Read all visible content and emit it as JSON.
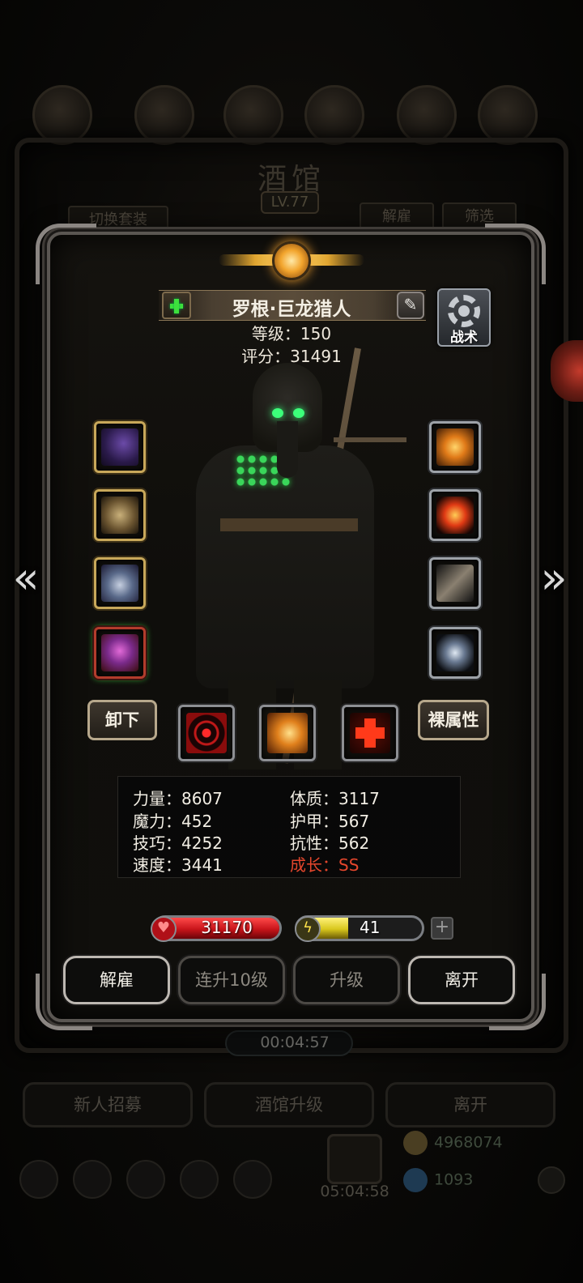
{
  "background": {
    "title": "酒馆",
    "level": "LV.77",
    "switch_outfit_label": "切换套装",
    "dismiss_label": "解雇",
    "filter_label": "筛选",
    "timer": "00:04:57",
    "recruit_label": "新人招募",
    "tavern_upgrade_label": "酒馆升级",
    "leave_label": "离开",
    "gift_timer": "05:04:58",
    "gold": "4968074",
    "gems": "1093"
  },
  "hero": {
    "name": "罗根·巨龙猎人",
    "level_text": "等级：150",
    "score_text": "评分：31491",
    "tactics_label": "战术"
  },
  "equipment": {
    "left": [
      {
        "icon": "pistol-icon",
        "frame": "gold"
      },
      {
        "icon": "armor-icon",
        "frame": "gold"
      },
      {
        "icon": "ring-icon",
        "frame": "gold"
      },
      {
        "icon": "gem-helm-icon",
        "frame": "red"
      }
    ],
    "right": [
      {
        "icon": "flame-ring-icon",
        "frame": "silver"
      },
      {
        "icon": "fire-orb-icon",
        "frame": "silver"
      },
      {
        "icon": "scroll-icon",
        "frame": "silver"
      },
      {
        "icon": "crest-icon",
        "frame": "silver"
      }
    ]
  },
  "actions_mid": {
    "unequip_label": "卸下",
    "base_attr_label": "裸属性"
  },
  "skills": [
    {
      "icon": "target-skill-icon"
    },
    {
      "icon": "strike-skill-icon"
    },
    {
      "icon": "heal-skill-icon"
    }
  ],
  "stats": {
    "strength": "力量：8607",
    "magic": "魔力：452",
    "skill": "技巧：4252",
    "speed": "速度：3441",
    "constitution": "体质：3117",
    "armor": "护甲：567",
    "resistance": "抗性：562",
    "growth": "成长：SS"
  },
  "hp": {
    "value": "31170",
    "fill_fraction": 1.0,
    "color": "#c8141a"
  },
  "energy": {
    "value": "41",
    "fill_fraction": 0.41,
    "color": "#d8c61c"
  },
  "buttons": {
    "dismiss": "解雇",
    "level_up_10": "连升10级",
    "level_up": "升级",
    "leave": "离开"
  },
  "colors": {
    "growth_red": "#e4462c",
    "gold_frame": "#c8a85a",
    "dialog_border": "#5a5652"
  }
}
